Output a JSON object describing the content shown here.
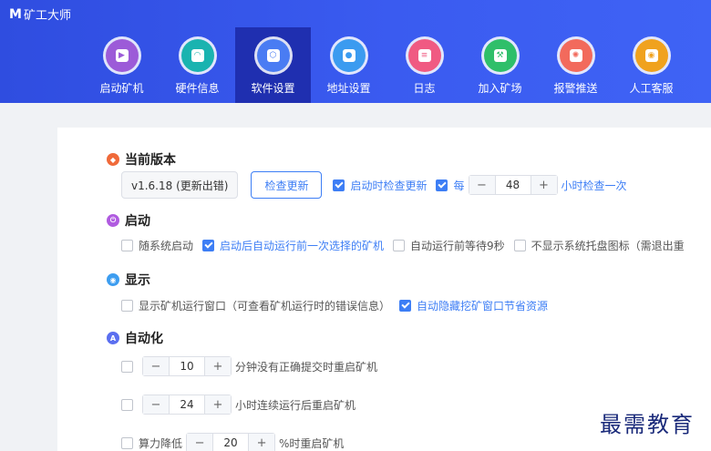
{
  "app": {
    "title": "矿工大师",
    "logo_icon": "M-logo-icon"
  },
  "nav": [
    {
      "label": "启动矿机",
      "icon": "play-icon",
      "color": "#9c5bd8",
      "active": false,
      "glyph": "▶"
    },
    {
      "label": "硬件信息",
      "icon": "gauge-icon",
      "color": "#1ab3b0",
      "active": false,
      "glyph": "◠"
    },
    {
      "label": "软件设置",
      "icon": "gear-icon",
      "color": "#4a7cf3",
      "active": true,
      "glyph": "⬡"
    },
    {
      "label": "地址设置",
      "icon": "pin-icon",
      "color": "#3b9bf0",
      "active": false,
      "glyph": "●"
    },
    {
      "label": "日志",
      "icon": "document-icon",
      "color": "#f05a82",
      "active": false,
      "glyph": "≡"
    },
    {
      "label": "加入矿场",
      "icon": "mine-icon",
      "color": "#2fbf6a",
      "active": false,
      "glyph": "⚒"
    },
    {
      "label": "报警推送",
      "icon": "alarm-icon",
      "color": "#f26a5c",
      "active": false,
      "glyph": "✺"
    },
    {
      "label": "人工客服",
      "icon": "support-icon",
      "color": "#f0a21e",
      "active": false,
      "glyph": "◉"
    }
  ],
  "sections": {
    "version": {
      "title": "当前版本",
      "icon_color": "#f06a3a",
      "version_text": "v1.6.18 (更新出错)",
      "check_button": "检查更新",
      "check_on_start": {
        "label": "启动时检查更新",
        "checked": true
      },
      "interval": {
        "prefix": "每",
        "value": "48",
        "suffix": "小时检查一次",
        "checked": true,
        "minus": "−",
        "plus": "+"
      }
    },
    "startup": {
      "title": "启动",
      "icon_color": "#b05be0",
      "options": [
        {
          "label": "随系统启动",
          "checked": false,
          "blue": false
        },
        {
          "label": "启动后自动运行前一次选择的矿机",
          "checked": true,
          "blue": true
        },
        {
          "label": "自动运行前等待9秒",
          "checked": false,
          "blue": false
        },
        {
          "label": "不显示系统托盘图标（需退出重",
          "checked": false,
          "blue": false
        }
      ]
    },
    "display": {
      "title": "显示",
      "icon_color": "#3d9df0",
      "options": [
        {
          "label": "显示矿机运行窗口（可查看矿机运行时的错误信息）",
          "checked": false,
          "blue": false
        },
        {
          "label": "自动隐藏挖矿窗口节省资源",
          "checked": true,
          "blue": true
        }
      ]
    },
    "automation": {
      "title": "自动化",
      "icon_color": "#5b6ff0",
      "icon_letter": "A",
      "rules": [
        {
          "prefix": "",
          "value": "10",
          "suffix": "分钟没有正确提交时重启矿机",
          "checked": false
        },
        {
          "prefix": "",
          "value": "24",
          "suffix": "小时连续运行后重启矿机",
          "checked": false
        },
        {
          "prefix": "算力降低",
          "value": "20",
          "suffix": "%时重启矿机",
          "checked": false
        }
      ]
    }
  },
  "watermark": "最需教育"
}
